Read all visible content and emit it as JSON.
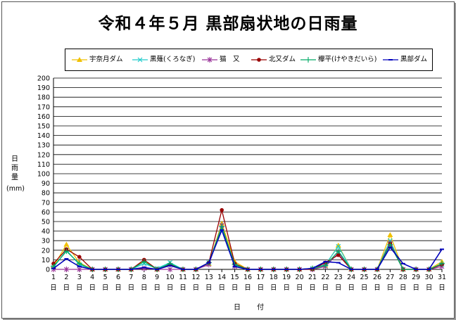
{
  "chart_data": {
    "type": "line",
    "title": "令和４年５月 黒部扇状地の日雨量",
    "ylabel": "日雨量",
    "yunit": "(mm)",
    "xlabel": "日 付",
    "ylim": [
      0,
      200
    ],
    "ytick_step": 10,
    "x": [
      1,
      2,
      3,
      4,
      5,
      6,
      7,
      8,
      9,
      10,
      11,
      12,
      13,
      14,
      15,
      16,
      17,
      18,
      19,
      20,
      21,
      22,
      23,
      24,
      25,
      26,
      27,
      28,
      29,
      30,
      31
    ],
    "x_suffix": "日",
    "legend_position": "top",
    "grid": true,
    "series": [
      {
        "name": "宇奈月ダム",
        "color": "#f0c000",
        "marker": "triangle",
        "values": [
          3,
          26,
          7,
          0,
          0,
          0,
          0,
          9,
          0,
          6,
          0,
          0,
          6,
          48,
          8,
          0,
          0,
          0,
          0,
          0,
          1,
          4,
          25,
          0,
          0,
          0,
          36,
          0,
          0,
          0,
          8
        ]
      },
      {
        "name": "黒薙(くろなぎ)",
        "color": "#22cccc",
        "marker": "x",
        "values": [
          2,
          20,
          5,
          0,
          0,
          0,
          0,
          6,
          1,
          7,
          0,
          0,
          7,
          43,
          4,
          0,
          0,
          0,
          0,
          0,
          1,
          5,
          24,
          0,
          0,
          0,
          30,
          0,
          0,
          0,
          5
        ]
      },
      {
        "name": "猫　又",
        "color": "#993399",
        "marker": "star",
        "values": [
          0,
          0,
          0,
          0,
          0,
          0,
          0,
          1,
          0,
          0,
          0,
          0,
          5,
          46,
          3,
          0,
          0,
          0,
          0,
          0,
          0,
          3,
          17,
          0,
          0,
          0,
          27,
          0,
          0,
          0,
          3
        ]
      },
      {
        "name": "北又ダム",
        "color": "#990000",
        "marker": "circle",
        "values": [
          6,
          21,
          13,
          0,
          0,
          0,
          0,
          10,
          0,
          5,
          0,
          0,
          7,
          62,
          6,
          0,
          0,
          0,
          0,
          0,
          0,
          7,
          15,
          0,
          0,
          0,
          27,
          0,
          0,
          0,
          5
        ]
      },
      {
        "name": "欅平(けやきだいら)",
        "color": "#00aa66",
        "marker": "plus",
        "values": [
          3,
          19,
          6,
          0,
          0,
          0,
          0,
          8,
          0,
          6,
          0,
          0,
          7,
          45,
          5,
          0,
          0,
          0,
          0,
          0,
          1,
          4,
          19,
          0,
          0,
          0,
          26,
          0,
          0,
          0,
          6
        ]
      },
      {
        "name": "黒部ダム",
        "color": "#0000bb",
        "marker": "dash",
        "values": [
          1,
          11,
          3,
          0,
          0,
          0,
          0,
          2,
          0,
          4,
          0,
          0,
          7,
          41,
          3,
          0,
          0,
          0,
          0,
          0,
          1,
          8,
          7,
          0,
          0,
          0,
          23,
          6,
          0,
          0,
          21
        ]
      }
    ]
  }
}
